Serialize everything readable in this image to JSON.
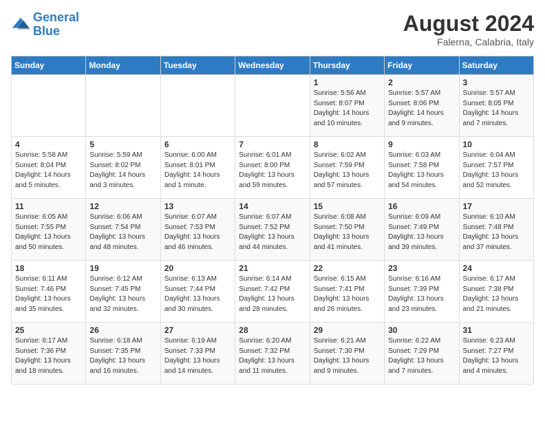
{
  "logo": {
    "line1": "General",
    "line2": "Blue"
  },
  "title": "August 2024",
  "location": "Falerna, Calabria, Italy",
  "weekdays": [
    "Sunday",
    "Monday",
    "Tuesday",
    "Wednesday",
    "Thursday",
    "Friday",
    "Saturday"
  ],
  "weeks": [
    [
      {
        "day": "",
        "info": ""
      },
      {
        "day": "",
        "info": ""
      },
      {
        "day": "",
        "info": ""
      },
      {
        "day": "",
        "info": ""
      },
      {
        "day": "1",
        "info": "Sunrise: 5:56 AM\nSunset: 8:07 PM\nDaylight: 14 hours\nand 10 minutes."
      },
      {
        "day": "2",
        "info": "Sunrise: 5:57 AM\nSunset: 8:06 PM\nDaylight: 14 hours\nand 9 minutes."
      },
      {
        "day": "3",
        "info": "Sunrise: 5:57 AM\nSunset: 8:05 PM\nDaylight: 14 hours\nand 7 minutes."
      }
    ],
    [
      {
        "day": "4",
        "info": "Sunrise: 5:58 AM\nSunset: 8:04 PM\nDaylight: 14 hours\nand 5 minutes."
      },
      {
        "day": "5",
        "info": "Sunrise: 5:59 AM\nSunset: 8:02 PM\nDaylight: 14 hours\nand 3 minutes."
      },
      {
        "day": "6",
        "info": "Sunrise: 6:00 AM\nSunset: 8:01 PM\nDaylight: 14 hours\nand 1 minute."
      },
      {
        "day": "7",
        "info": "Sunrise: 6:01 AM\nSunset: 8:00 PM\nDaylight: 13 hours\nand 59 minutes."
      },
      {
        "day": "8",
        "info": "Sunrise: 6:02 AM\nSunset: 7:59 PM\nDaylight: 13 hours\nand 57 minutes."
      },
      {
        "day": "9",
        "info": "Sunrise: 6:03 AM\nSunset: 7:58 PM\nDaylight: 13 hours\nand 54 minutes."
      },
      {
        "day": "10",
        "info": "Sunrise: 6:04 AM\nSunset: 7:57 PM\nDaylight: 13 hours\nand 52 minutes."
      }
    ],
    [
      {
        "day": "11",
        "info": "Sunrise: 6:05 AM\nSunset: 7:55 PM\nDaylight: 13 hours\nand 50 minutes."
      },
      {
        "day": "12",
        "info": "Sunrise: 6:06 AM\nSunset: 7:54 PM\nDaylight: 13 hours\nand 48 minutes."
      },
      {
        "day": "13",
        "info": "Sunrise: 6:07 AM\nSunset: 7:53 PM\nDaylight: 13 hours\nand 46 minutes."
      },
      {
        "day": "14",
        "info": "Sunrise: 6:07 AM\nSunset: 7:52 PM\nDaylight: 13 hours\nand 44 minutes."
      },
      {
        "day": "15",
        "info": "Sunrise: 6:08 AM\nSunset: 7:50 PM\nDaylight: 13 hours\nand 41 minutes."
      },
      {
        "day": "16",
        "info": "Sunrise: 6:09 AM\nSunset: 7:49 PM\nDaylight: 13 hours\nand 39 minutes."
      },
      {
        "day": "17",
        "info": "Sunrise: 6:10 AM\nSunset: 7:48 PM\nDaylight: 13 hours\nand 37 minutes."
      }
    ],
    [
      {
        "day": "18",
        "info": "Sunrise: 6:11 AM\nSunset: 7:46 PM\nDaylight: 13 hours\nand 35 minutes."
      },
      {
        "day": "19",
        "info": "Sunrise: 6:12 AM\nSunset: 7:45 PM\nDaylight: 13 hours\nand 32 minutes."
      },
      {
        "day": "20",
        "info": "Sunrise: 6:13 AM\nSunset: 7:44 PM\nDaylight: 13 hours\nand 30 minutes."
      },
      {
        "day": "21",
        "info": "Sunrise: 6:14 AM\nSunset: 7:42 PM\nDaylight: 13 hours\nand 28 minutes."
      },
      {
        "day": "22",
        "info": "Sunrise: 6:15 AM\nSunset: 7:41 PM\nDaylight: 13 hours\nand 26 minutes."
      },
      {
        "day": "23",
        "info": "Sunrise: 6:16 AM\nSunset: 7:39 PM\nDaylight: 13 hours\nand 23 minutes."
      },
      {
        "day": "24",
        "info": "Sunrise: 6:17 AM\nSunset: 7:38 PM\nDaylight: 13 hours\nand 21 minutes."
      }
    ],
    [
      {
        "day": "25",
        "info": "Sunrise: 6:17 AM\nSunset: 7:36 PM\nDaylight: 13 hours\nand 18 minutes."
      },
      {
        "day": "26",
        "info": "Sunrise: 6:18 AM\nSunset: 7:35 PM\nDaylight: 13 hours\nand 16 minutes."
      },
      {
        "day": "27",
        "info": "Sunrise: 6:19 AM\nSunset: 7:33 PM\nDaylight: 13 hours\nand 14 minutes."
      },
      {
        "day": "28",
        "info": "Sunrise: 6:20 AM\nSunset: 7:32 PM\nDaylight: 13 hours\nand 11 minutes."
      },
      {
        "day": "29",
        "info": "Sunrise: 6:21 AM\nSunset: 7:30 PM\nDaylight: 13 hours\nand 9 minutes."
      },
      {
        "day": "30",
        "info": "Sunrise: 6:22 AM\nSunset: 7:29 PM\nDaylight: 13 hours\nand 7 minutes."
      },
      {
        "day": "31",
        "info": "Sunrise: 6:23 AM\nSunset: 7:27 PM\nDaylight: 13 hours\nand 4 minutes."
      }
    ]
  ]
}
